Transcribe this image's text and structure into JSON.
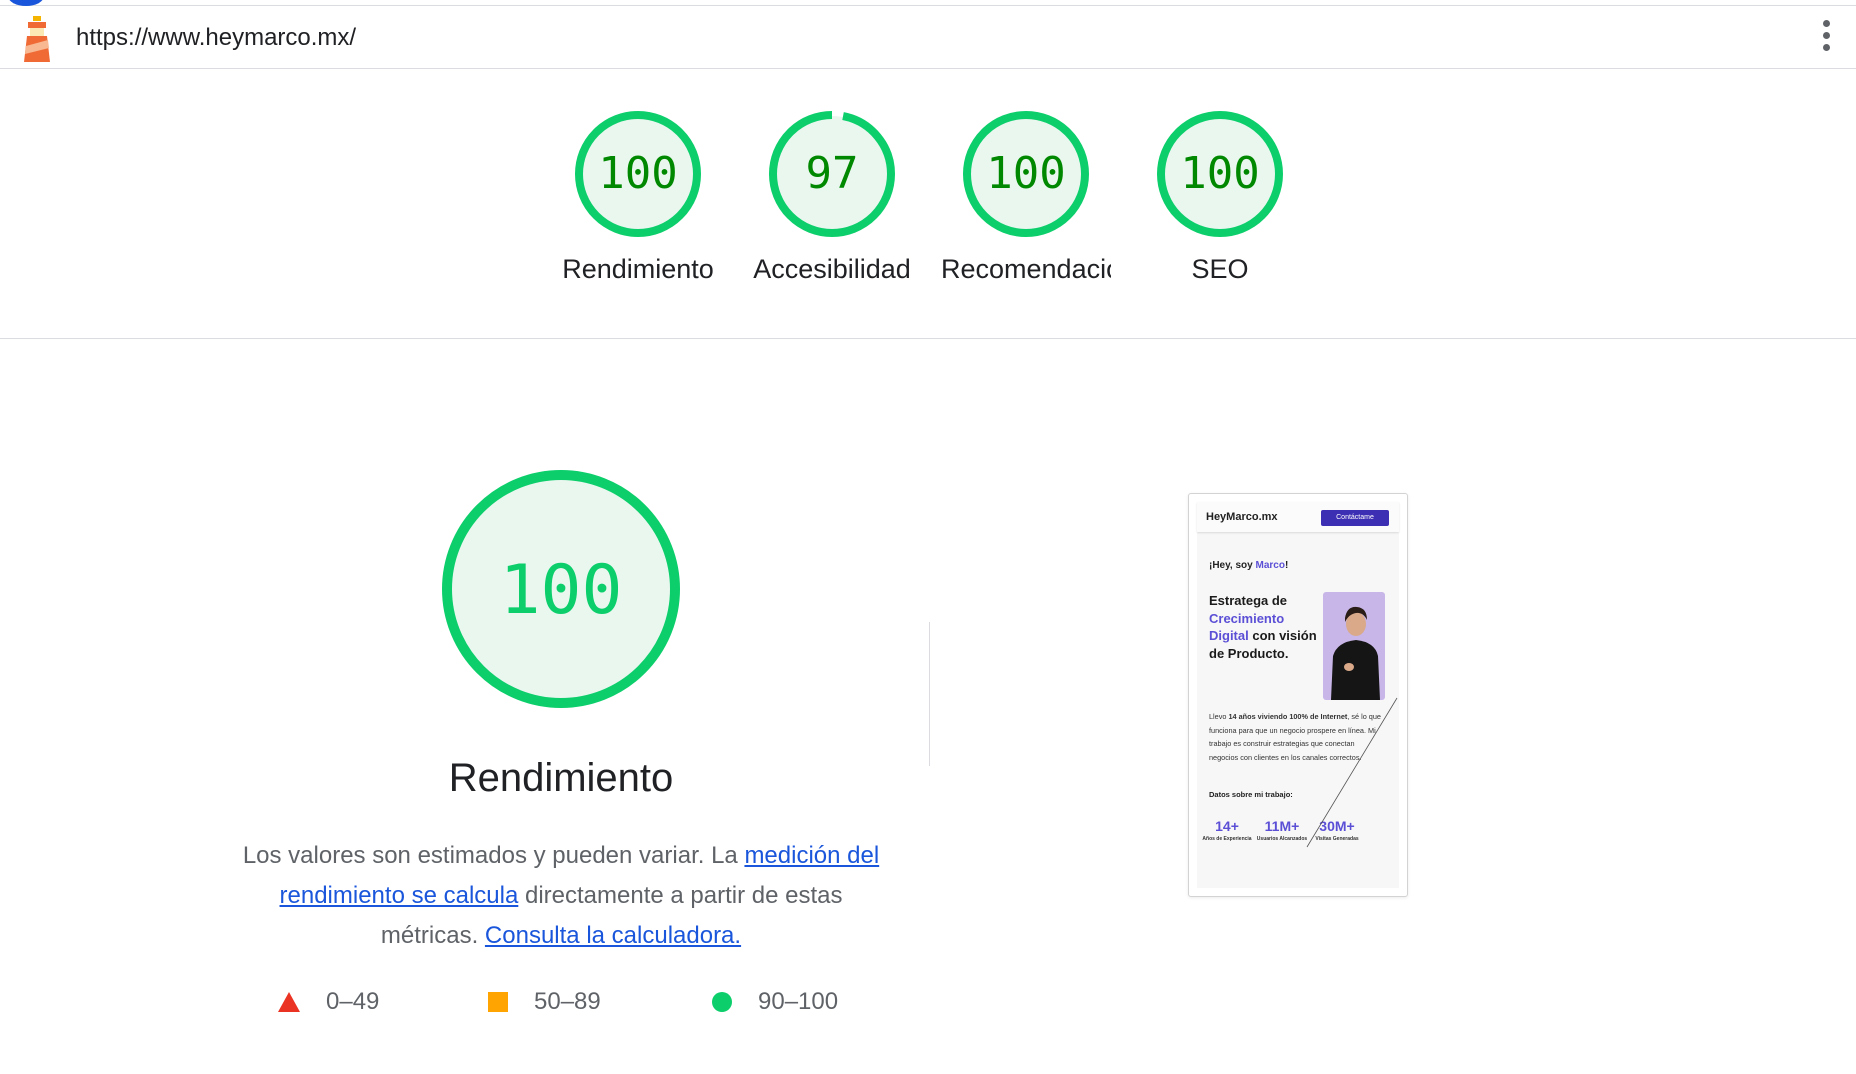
{
  "browser": {
    "url": "https://www.heymarco.mx/"
  },
  "summary": [
    {
      "score": "100",
      "value": 100,
      "label": "Rendimiento",
      "clipped": false
    },
    {
      "score": "97",
      "value": 97,
      "label": "Accesibilidad",
      "clipped": false
    },
    {
      "score": "100",
      "value": 100,
      "label": "Recomendaciones",
      "clipped": true
    },
    {
      "score": "100",
      "value": 100,
      "label": "SEO",
      "clipped": false
    }
  ],
  "performance": {
    "score": "100",
    "title": "Rendimiento",
    "desc_text_1": "Los valores son estimados y pueden variar. La ",
    "desc_link_1": "medición del rendimiento se calcula",
    "desc_text_2": " directamente a partir de estas métricas. ",
    "desc_link_2": "Consulta la calculadora."
  },
  "legend": [
    {
      "range": "0–49",
      "shape": "triangle",
      "color": "#eb3323"
    },
    {
      "range": "50–89",
      "shape": "square",
      "color": "#ffa400"
    },
    {
      "range": "90–100",
      "shape": "circle",
      "color": "#0cce6b"
    }
  ],
  "colors": {
    "pass": "#0cce6b",
    "pass_text": "#008800",
    "pass_bg": "#e9f7ef",
    "link": "#1a56db"
  },
  "screenshot": {
    "brand": "HeyMarco.mx",
    "cta": "Contáctame",
    "greeting_1": "¡Hey, soy ",
    "greeting_name": "Marco",
    "greeting_2": "!",
    "headline_1": "Estratega de ",
    "headline_hl": "Crecimiento Digital",
    "headline_2": " con visión de Producto.",
    "para_1": "Llevo ",
    "para_bold": "14 años viviendo 100% de Internet",
    "para_2": ", sé lo que funciona para que un negocio prospere en línea. Mi trabajo es construir estrategias que conectan negocios con clientes en los canales correctos.",
    "datos": "Datos sobre mi trabajo:",
    "stats": [
      {
        "value": "14+",
        "caption": "Años de Experiencia"
      },
      {
        "value": "11M+",
        "caption": "Usuarios Alcanzados"
      },
      {
        "value": "30M+",
        "caption": "Visitas Generadas"
      }
    ]
  }
}
